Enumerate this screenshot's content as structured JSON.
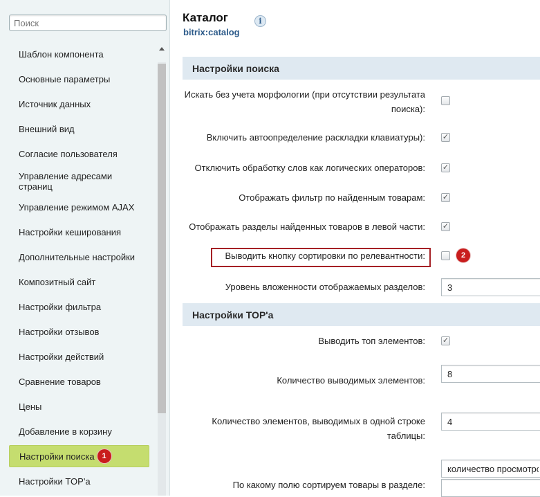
{
  "sidebar": {
    "search_placeholder": "Поиск",
    "items": [
      {
        "label": "Шаблон компонента"
      },
      {
        "label": "Основные параметры"
      },
      {
        "label": "Источник данных"
      },
      {
        "label": "Внешний вид"
      },
      {
        "label": "Согласие пользователя"
      },
      {
        "label": "Управление адресами страниц"
      },
      {
        "label": "Управление режимом AJAX"
      },
      {
        "label": "Настройки кеширования"
      },
      {
        "label": "Дополнительные настройки"
      },
      {
        "label": "Композитный сайт"
      },
      {
        "label": "Настройки фильтра"
      },
      {
        "label": "Настройки отзывов"
      },
      {
        "label": "Настройки действий"
      },
      {
        "label": "Сравнение товаров"
      },
      {
        "label": "Цены"
      },
      {
        "label": "Добавление в корзину"
      },
      {
        "label": "Настройки поиска",
        "active": true,
        "badge": "1"
      },
      {
        "label": "Настройки TOP'а"
      }
    ]
  },
  "header": {
    "title": "Каталог",
    "subtitle": "bitrix:catalog",
    "info_icon": "i"
  },
  "sections": {
    "search": {
      "title": "Настройки поиска",
      "fields": [
        {
          "label": "Искать без учета морфологии (при отсутствии результата поиска):",
          "type": "checkbox",
          "checked": false
        },
        {
          "label": "Включить автоопределение раскладки клавиатуры):",
          "type": "checkbox",
          "checked": true
        },
        {
          "label": "Отключить обработку слов как логических операторов:",
          "type": "checkbox",
          "checked": true
        },
        {
          "label": "Отображать фильтр по найденным товарам:",
          "type": "checkbox",
          "checked": true
        },
        {
          "label": "Отображать разделы найденных товаров в левой части:",
          "type": "checkbox",
          "checked": true
        },
        {
          "label": "Выводить кнопку сортировки по релевантности:",
          "type": "checkbox",
          "checked": false,
          "badge": "2"
        },
        {
          "label": "Уровень вложенности отображаемых разделов:",
          "type": "input",
          "value": "3"
        }
      ]
    },
    "top": {
      "title": "Настройки TOP'а",
      "fields": [
        {
          "label": "Выводить топ элементов:",
          "type": "checkbox",
          "checked": true
        },
        {
          "label": "Количество выводимых элементов:",
          "type": "input",
          "value": "8"
        },
        {
          "label": "Количество элементов, выводимых в одной строке таблицы:",
          "type": "input",
          "value": "4"
        },
        {
          "label": "",
          "type": "select",
          "value": "количество просмотров"
        },
        {
          "label": "По какому полю сортируем товары в разделе:",
          "type": "input",
          "value": ""
        }
      ]
    }
  },
  "colors": {
    "active_item": "#c5dd6f",
    "badge": "#c91d1d",
    "highlight_border": "#a52025",
    "section_header": "#dfe9f1",
    "subtitle": "#2d5b8a"
  },
  "icons": {
    "checkmark": "✓",
    "scroll_up": "triangle-up"
  }
}
